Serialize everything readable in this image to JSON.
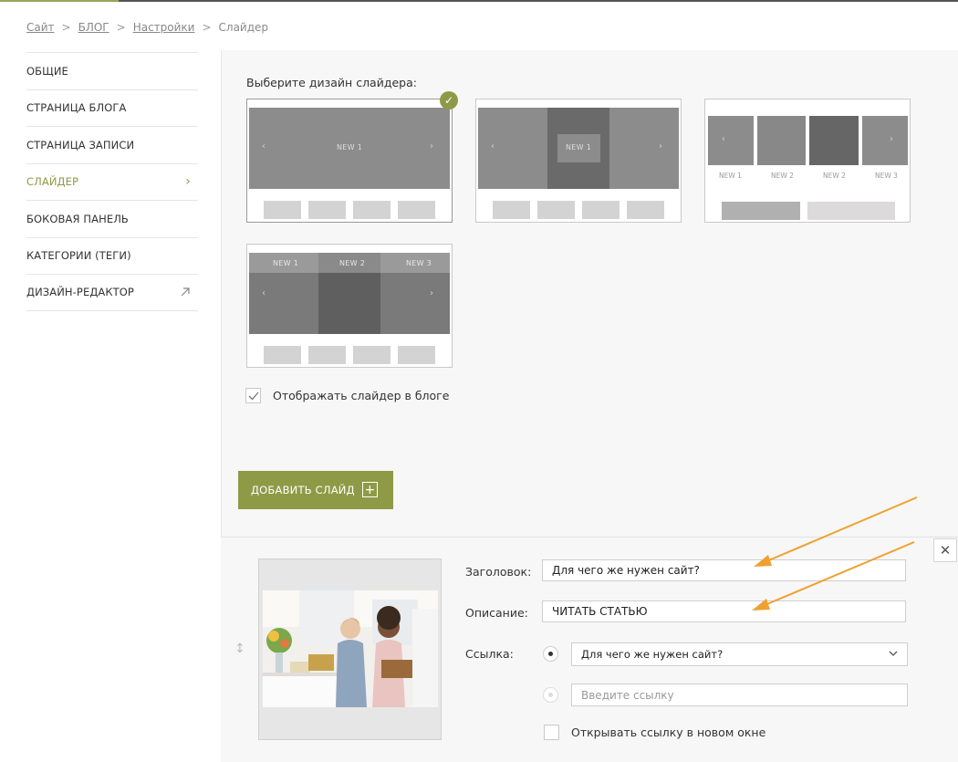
{
  "breadcrumb": {
    "items": [
      "Сайт",
      "БЛОГ",
      "Настройки"
    ],
    "current": "Слайдер",
    "separator": ">"
  },
  "sidebar": {
    "items": [
      {
        "label": "ОБЩИЕ"
      },
      {
        "label": "СТРАНИЦА БЛОГА"
      },
      {
        "label": "СТРАНИЦА ЗАПИСИ"
      },
      {
        "label": "СЛАЙДЕР",
        "active": true
      },
      {
        "label": "БОКОВАЯ ПАНЕЛЬ"
      },
      {
        "label": "КАТЕГОРИИ (ТЕГИ)"
      },
      {
        "label": "ДИЗАЙН-РЕДАКТОР",
        "external": true
      }
    ]
  },
  "designs": {
    "label": "Выберите дизайн слайдера:",
    "d1": {
      "caption": "NEW 1"
    },
    "d2": {
      "caption": "NEW 1"
    },
    "d3": {
      "captions": [
        "NEW 1",
        "NEW 2",
        "NEW 2",
        "NEW 3"
      ]
    },
    "d4": {
      "captions": [
        "NEW 1",
        "NEW 2",
        "NEW 3"
      ]
    },
    "selected_index": 0
  },
  "show_slider": {
    "label": "Отображать слайдер в блоге",
    "checked": true
  },
  "add_slide": {
    "label": "ДОБАВИТЬ СЛАЙД"
  },
  "slide": {
    "title_label": "Заголовок:",
    "title_value": "Для чего же нужен сайт?",
    "desc_label": "Описание:",
    "desc_value": "ЧИТАТЬ СТАТЬЮ",
    "link_label": "Ссылка:",
    "link_select_value": "Для чего же нужен сайт?",
    "link_placeholder": "Введите ссылку",
    "new_window_label": "Открывать ссылку в новом окне",
    "new_window_checked": false
  },
  "colors": {
    "accent": "#8f9a46",
    "annotation_arrow": "#f0a030"
  }
}
